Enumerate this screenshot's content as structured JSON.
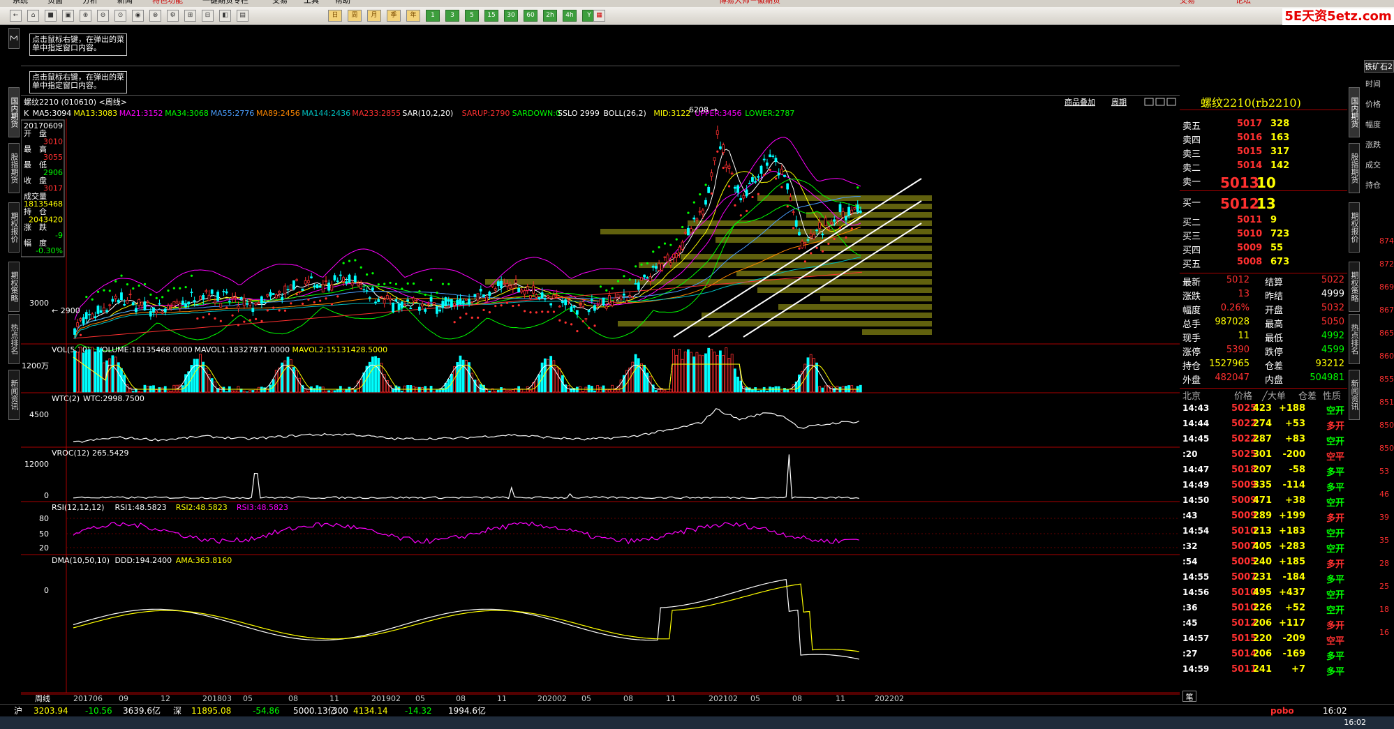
{
  "menu": [
    "系统",
    "页面",
    "分析",
    "新闻",
    "特色功能",
    "一键期货专栏",
    "交易",
    "工具",
    "帮助"
  ],
  "window_title": "博易大师－徽期货",
  "top_right": [
    "交易",
    "论坛"
  ],
  "logo_text": "5E天资5etz.com",
  "toolbar_buttons": [
    "日",
    "周",
    "月",
    "季",
    "年",
    "1",
    "3",
    "5",
    "15",
    "30",
    "60",
    "2h",
    "4h",
    "Y"
  ],
  "side_tabs_left": [
    "国内期货",
    "股指期货",
    "期权报价",
    "期权策略",
    "热点排名",
    "新闻资讯"
  ],
  "side_tabs_right": [
    "国内期货",
    "股指期货",
    "期权报价",
    "期权策略",
    "热点排名",
    "新闻资讯"
  ],
  "hint_text": "点击鼠标右键，在弹出的菜单中指定窗口内容。",
  "chart_header": {
    "instrument": "螺纹2210 (010610) <周线>",
    "overlay_btn": "商品叠加",
    "period_btn": "周期"
  },
  "indicator_line": [
    {
      "text": "K",
      "color": "#ffffff"
    },
    {
      "text": "MA5:3094",
      "color": "#ffffff"
    },
    {
      "text": "MA13:3083",
      "color": "#ffff00"
    },
    {
      "text": "MA21:3152",
      "color": "#ff00ff"
    },
    {
      "text": "MA34:3068",
      "color": "#00ff00"
    },
    {
      "text": "MA55:2776",
      "color": "#4a9eff"
    },
    {
      "text": "MA89:2456",
      "color": "#ff8800"
    },
    {
      "text": "MA144:2436",
      "color": "#00c0c0"
    },
    {
      "text": "MA233:2855",
      "color": "#ff3030"
    },
    {
      "text": "SAR(10,2,20)",
      "color": "#ffffff"
    },
    {
      "text": "SARUP:2790",
      "color": "#ff3030"
    },
    {
      "text": "SARDOWN:0",
      "color": "#00ff00"
    },
    {
      "text": "SSLO 2999",
      "color": "#ffffff"
    },
    {
      "text": "BOLL(26,2)",
      "color": "#ffffff"
    },
    {
      "text": "MID:3122",
      "color": "#ffff00"
    },
    {
      "text": "UPPER:3456",
      "color": "#ff00ff"
    },
    {
      "text": "LOWER:2787",
      "color": "#00ff00"
    }
  ],
  "info_box": {
    "date": "20170609",
    "open_label": "开　盘",
    "open": "3010",
    "high_label": "最　高",
    "high": "3055",
    "low_label": "最　低",
    "low": "2906",
    "close_label": "收　盘",
    "close": "3017",
    "vol_label": "成交量",
    "vol": "18135468",
    "oi_label": "持　仓",
    "oi": "2043420",
    "chg_label": "涨　跌",
    "chg": "-9",
    "pct_label": "幅　度",
    "pct": "-0.30%"
  },
  "price_axis": [
    "3000"
  ],
  "price_marks": {
    "low_mark": "2900",
    "high_mark": "6208"
  },
  "panels": [
    {
      "title": "VOL(5,10)",
      "vals": [
        {
          "t": "VOLUME:18135468.0000",
          "c": "#ffffff"
        },
        {
          "t": "MAVOL1:18327871.0000",
          "c": "#ffffff"
        },
        {
          "t": "MAVOL2:15131428.5000",
          "c": "#ffff00"
        }
      ],
      "axis": [
        "1200万"
      ]
    },
    {
      "title": "WTC(2)",
      "vals": [
        {
          "t": "WTC:2998.7500",
          "c": "#ffffff"
        }
      ],
      "axis": [
        "4500"
      ]
    },
    {
      "title": "VROC(12)",
      "vals": [
        {
          "t": "265.5429",
          "c": "#ffffff"
        }
      ],
      "axis": [
        "12000",
        "0"
      ]
    },
    {
      "title": "RSI(12,12,12)",
      "vals": [
        {
          "t": "RSI1:48.5823",
          "c": "#ffffff"
        },
        {
          "t": "RSI2:48.5823",
          "c": "#ffff00"
        },
        {
          "t": "RSI3:48.5823",
          "c": "#ff00ff"
        }
      ],
      "axis": [
        "80",
        "50",
        "20"
      ]
    },
    {
      "title": "DMA(10,50,10)",
      "vals": [
        {
          "t": "DDD:194.2400",
          "c": "#ffffff"
        },
        {
          "t": "AMA:363.8160",
          "c": "#ffff00"
        }
      ],
      "axis": [
        "0"
      ]
    }
  ],
  "x_axis": {
    "period_label": "周线",
    "ticks": [
      "201706",
      "09",
      "12",
      "201803",
      "05",
      "08",
      "11",
      "201902",
      "05",
      "08",
      "11",
      "202002",
      "05",
      "08",
      "11",
      "202102",
      "05",
      "08",
      "11",
      "202202"
    ]
  },
  "quote": {
    "title": "螺纹2210(rb2210)",
    "asks": [
      {
        "label": "卖五",
        "price": "5017",
        "vol": "328"
      },
      {
        "label": "卖四",
        "price": "5016",
        "vol": "163"
      },
      {
        "label": "卖三",
        "price": "5015",
        "vol": "317"
      },
      {
        "label": "卖二",
        "price": "5014",
        "vol": "142"
      },
      {
        "label": "卖一",
        "price": "5013",
        "vol": "10"
      }
    ],
    "bids": [
      {
        "label": "买一",
        "price": "5012",
        "vol": "13"
      },
      {
        "label": "买二",
        "price": "5011",
        "vol": "9"
      },
      {
        "label": "买三",
        "price": "5010",
        "vol": "723"
      },
      {
        "label": "买四",
        "price": "5009",
        "vol": "55"
      },
      {
        "label": "买五",
        "price": "5008",
        "vol": "673"
      }
    ],
    "stats": [
      {
        "l1": "最新",
        "v1": "5012",
        "c1": "#ff3030",
        "l2": "结算",
        "v2": "5022",
        "c2": "#ff3030"
      },
      {
        "l1": "涨跌",
        "v1": "13",
        "c1": "#ff3030",
        "l2": "昨结",
        "v2": "4999",
        "c2": "#ffffff"
      },
      {
        "l1": "幅度",
        "v1": "0.26%",
        "c1": "#ff3030",
        "l2": "开盘",
        "v2": "5032",
        "c2": "#ff3030"
      },
      {
        "l1": "总手",
        "v1": "987028",
        "c1": "#ffff00",
        "l2": "最高",
        "v2": "5050",
        "c2": "#ff3030"
      },
      {
        "l1": "现手",
        "v1": "11",
        "c1": "#ffff00",
        "l2": "最低",
        "v2": "4992",
        "c2": "#00ff00"
      },
      {
        "l1": "涨停",
        "v1": "5390",
        "c1": "#ff3030",
        "l2": "跌停",
        "v2": "4599",
        "c2": "#00ff00"
      },
      {
        "l1": "持仓",
        "v1": "1527965",
        "c1": "#ffff00",
        "l2": "仓差",
        "v2": "93212",
        "c2": "#ffff00"
      },
      {
        "l1": "外盘",
        "v1": "482047",
        "c1": "#ff3030",
        "l2": "内盘",
        "v2": "504981",
        "c2": "#00ff00"
      }
    ],
    "tick_header": [
      "北京",
      "价格",
      "╱大单",
      "仓差",
      "性质"
    ],
    "ticks": [
      {
        "t": "14:43",
        "p": "5025",
        "v": "423",
        "d": "+188",
        "n": "空开",
        "pc": "#ff3030",
        "nc": "#00ff00"
      },
      {
        "t": "14:44",
        "p": "5022",
        "v": "274",
        "d": "+53",
        "n": "多开",
        "pc": "#ff3030",
        "nc": "#ff3030"
      },
      {
        "t": "14:45",
        "p": "5022",
        "v": "287",
        "d": "+83",
        "n": "空开",
        "pc": "#ff3030",
        "nc": "#00ff00"
      },
      {
        "t": ":20",
        "p": "5025",
        "v": "301",
        "d": "-200",
        "n": "空平",
        "pc": "#ff3030",
        "nc": "#ff3030"
      },
      {
        "t": "14:47",
        "p": "5018",
        "v": "207",
        "d": "-58",
        "n": "多平",
        "pc": "#ff3030",
        "nc": "#00ff00"
      },
      {
        "t": "14:49",
        "p": "5009",
        "v": "335",
        "d": "-114",
        "n": "多平",
        "pc": "#ff3030",
        "nc": "#00ff00"
      },
      {
        "t": "14:50",
        "p": "5009",
        "v": "471",
        "d": "+38",
        "n": "空开",
        "pc": "#ff3030",
        "nc": "#00ff00"
      },
      {
        "t": ":43",
        "p": "5009",
        "v": "289",
        "d": "+199",
        "n": "多开",
        "pc": "#ff3030",
        "nc": "#ff3030"
      },
      {
        "t": "14:54",
        "p": "5010",
        "v": "213",
        "d": "+183",
        "n": "空开",
        "pc": "#ff3030",
        "nc": "#00ff00"
      },
      {
        "t": ":32",
        "p": "5007",
        "v": "405",
        "d": "+283",
        "n": "空开",
        "pc": "#ff3030",
        "nc": "#00ff00"
      },
      {
        "t": ":54",
        "p": "5005",
        "v": "240",
        "d": "+185",
        "n": "多开",
        "pc": "#ff3030",
        "nc": "#ff3030"
      },
      {
        "t": "14:55",
        "p": "5007",
        "v": "231",
        "d": "-184",
        "n": "多平",
        "pc": "#ff3030",
        "nc": "#00ff00"
      },
      {
        "t": "14:56",
        "p": "5010",
        "v": "495",
        "d": "+437",
        "n": "空开",
        "pc": "#ff3030",
        "nc": "#00ff00"
      },
      {
        "t": ":36",
        "p": "5010",
        "v": "226",
        "d": "+52",
        "n": "空开",
        "pc": "#ff3030",
        "nc": "#00ff00"
      },
      {
        "t": ":45",
        "p": "5012",
        "v": "206",
        "d": "+117",
        "n": "多开",
        "pc": "#ff3030",
        "nc": "#ff3030"
      },
      {
        "t": "14:57",
        "p": "5015",
        "v": "220",
        "d": "-209",
        "n": "空平",
        "pc": "#ff3030",
        "nc": "#ff3030"
      },
      {
        "t": ":27",
        "p": "5014",
        "v": "206",
        "d": "-169",
        "n": "多平",
        "pc": "#ff3030",
        "nc": "#00ff00"
      },
      {
        "t": "14:59",
        "p": "5011",
        "v": "241",
        "d": "+7",
        "n": "多平",
        "pc": "#ff3030",
        "nc": "#00ff00"
      }
    ],
    "bottom_tab": "笔"
  },
  "far_right": {
    "title": "铁矿石2",
    "labels": [
      "时间",
      "价格",
      "幅度",
      "涨跌",
      "成交",
      "持仓"
    ],
    "values": [
      "874",
      "872",
      "869",
      "867",
      "865",
      "860",
      "855",
      "851",
      "850",
      "850",
      "53",
      "46",
      "39",
      "35",
      "28",
      "25",
      "18",
      "16"
    ]
  },
  "status_bar": [
    {
      "t": "沪",
      "c": "#ffffff"
    },
    {
      "t": "3203.94",
      "c": "#ffff00"
    },
    {
      "t": "-10.56",
      "c": "#00ff00"
    },
    {
      "t": "3639.6亿",
      "c": "#ffffff"
    },
    {
      "t": "深",
      "c": "#ffffff"
    },
    {
      "t": "11895.08",
      "c": "#ffff00"
    },
    {
      "t": "-54.86",
      "c": "#00ff00"
    },
    {
      "t": "5000.13亿",
      "c": "#ffffff"
    },
    {
      "t": "300",
      "c": "#ffffff"
    },
    {
      "t": "4134.14",
      "c": "#ffff00"
    },
    {
      "t": "-14.32",
      "c": "#00ff00"
    },
    {
      "t": "1994.6亿",
      "c": "#ffffff"
    }
  ],
  "status_right": {
    "brand": "pobo",
    "time": "16:02"
  },
  "taskbar_time": "16:02"
}
